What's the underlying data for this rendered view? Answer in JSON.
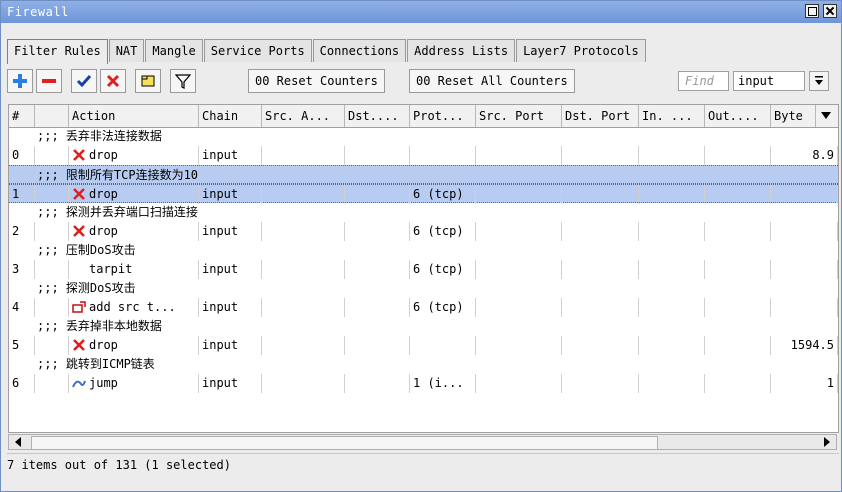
{
  "window": {
    "title": "Firewall"
  },
  "tabs": [
    "Filter Rules",
    "NAT",
    "Mangle",
    "Service Ports",
    "Connections",
    "Address Lists",
    "Layer7 Protocols"
  ],
  "toolbar": {
    "reset_counters": "00 Reset Counters",
    "reset_all_counters": "00 Reset All Counters",
    "find_placeholder": "Find",
    "chain_filter": "input"
  },
  "columns": [
    "#",
    "Action",
    "Chain",
    "Src. A...",
    "Dst....",
    "Prot...",
    "Src. Port",
    "Dst. Port",
    "In. ...",
    "Out....",
    "Byte"
  ],
  "rules": [
    {
      "comment": ";;; 丢弃非法连接数据",
      "num": "0",
      "action": "drop",
      "chain": "input",
      "proto": "",
      "bytes": "8.9"
    },
    {
      "comment": ";;; 限制所有TCP连接数为10",
      "num": "1",
      "action": "drop",
      "chain": "input",
      "proto": "6 (tcp)",
      "bytes": ""
    },
    {
      "comment": ";;; 探测并丢弃端口扫描连接",
      "num": "2",
      "action": "drop",
      "chain": "input",
      "proto": "6 (tcp)",
      "bytes": ""
    },
    {
      "comment": ";;; 压制DoS攻击",
      "num": "3",
      "action": "tarpit",
      "chain": "input",
      "proto": "6 (tcp)",
      "bytes": ""
    },
    {
      "comment": ";;; 探测DoS攻击",
      "num": "4",
      "action": "add src t...",
      "chain": "input",
      "proto": "6 (tcp)",
      "bytes": ""
    },
    {
      "comment": ";;; 丢弃掉非本地数据",
      "num": "5",
      "action": "drop",
      "chain": "input",
      "proto": "",
      "bytes": "1594.5"
    },
    {
      "comment": ";;; 跳转到ICMP链表",
      "num": "6",
      "action": "jump",
      "chain": "input",
      "proto": "1 (i...",
      "bytes": "1"
    }
  ],
  "selected_rule": "1",
  "status": "7 items out of 131 (1 selected)",
  "colors": {
    "titlebar": "#7ea2e0",
    "selection": "#b7ccf0",
    "drop": "#e02020",
    "add": "#2a7de1",
    "remove": "#e02020"
  }
}
